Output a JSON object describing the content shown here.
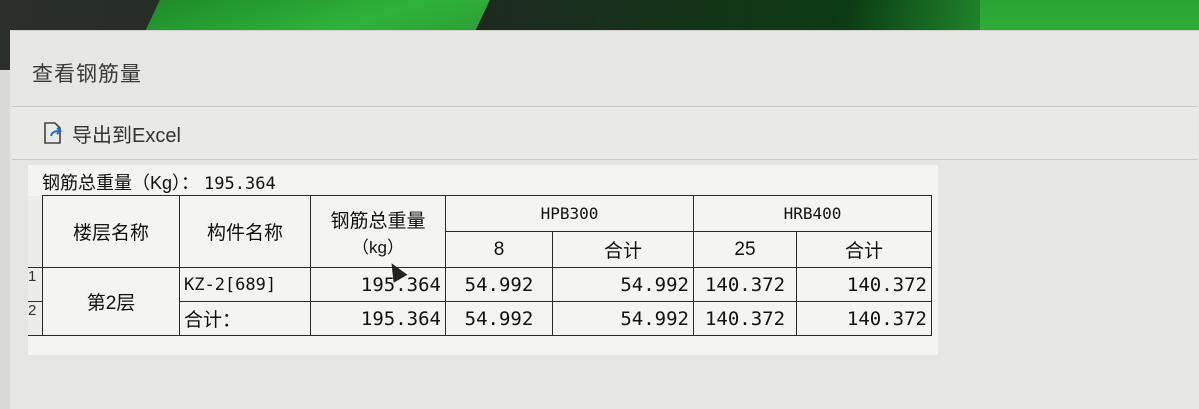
{
  "window": {
    "title": "查看钢筋量"
  },
  "toolbar": {
    "export_label": "导出到Excel"
  },
  "summary": {
    "label": "钢筋总重量（Kg）：",
    "value": "195.364"
  },
  "table": {
    "headers": {
      "floor": "楼层名称",
      "component": "构件名称",
      "total_weight_line1": "钢筋总重量",
      "total_weight_line2": "（kg）",
      "group1": "HPB300",
      "group2": "HRB400",
      "g1_sub1": "8",
      "g1_sub2": "合计",
      "g2_sub1": "25",
      "g2_sub2": "合计"
    },
    "rows": [
      {
        "index": "1",
        "floor": "第2层",
        "component": "KZ-2[689]",
        "total": "195.364",
        "g1_v1": "54.992",
        "g1_total": "54.992",
        "g2_v1": "140.372",
        "g2_total": "140.372"
      },
      {
        "index": "2",
        "component": "合计：",
        "total": "195.364",
        "g1_v1": "54.992",
        "g1_total": "54.992",
        "g2_v1": "140.372",
        "g2_total": "140.372"
      }
    ]
  },
  "colors": {
    "header_bg": "#f4f4f2",
    "border": "#2a2a2a",
    "window_bg": "#e6e6e3"
  }
}
